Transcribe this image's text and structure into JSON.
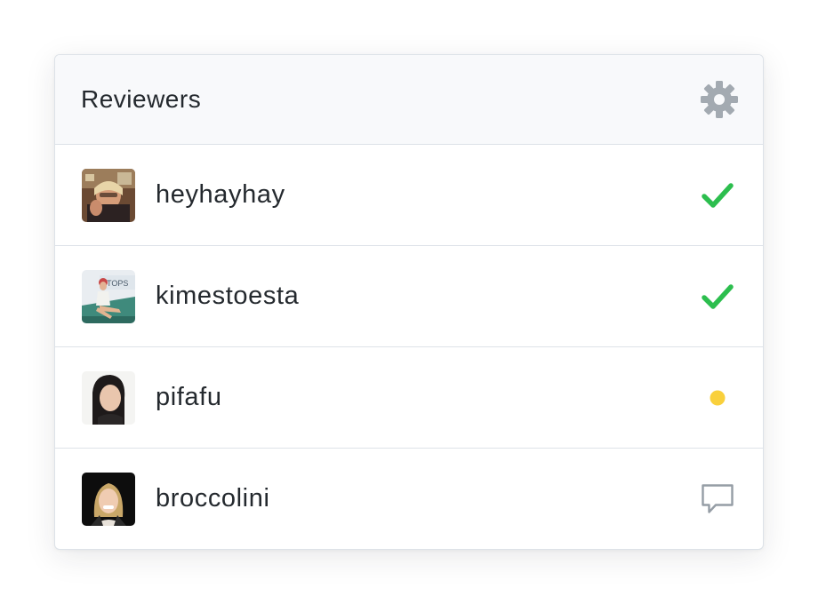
{
  "panel": {
    "title": "Reviewers",
    "settings_icon": "gear-icon"
  },
  "colors": {
    "approved": "#2cbe4e",
    "pending": "#f9d03c",
    "commented": "#959da5",
    "gear": "#a3aab1",
    "text": "#24292e"
  },
  "reviewers": [
    {
      "username": "heyhayhay",
      "status": "approved",
      "status_icon": "check-icon"
    },
    {
      "username": "kimestoesta",
      "status": "approved",
      "status_icon": "check-icon"
    },
    {
      "username": "pifafu",
      "status": "pending",
      "status_icon": "dot-icon"
    },
    {
      "username": "broccolini",
      "status": "commented",
      "status_icon": "comment-icon"
    }
  ]
}
